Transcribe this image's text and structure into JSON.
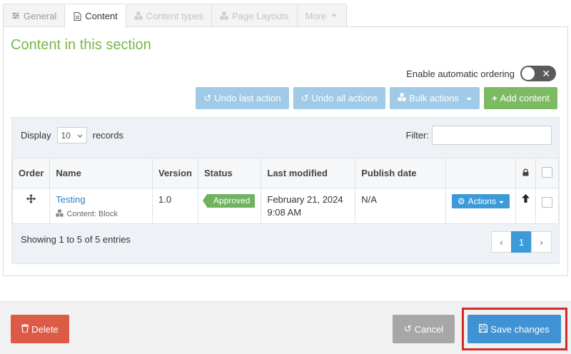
{
  "tabs": [
    {
      "label": "General",
      "icon": "sliders-icon"
    },
    {
      "label": "Content",
      "icon": "document-icon"
    },
    {
      "label": "Content types",
      "icon": "cubes-icon"
    },
    {
      "label": "Page Layouts",
      "icon": "cubes-icon"
    },
    {
      "label": "More",
      "icon": "caret-down-icon"
    }
  ],
  "section": {
    "title": "Content in this section",
    "auto_ordering_label": "Enable automatic ordering",
    "auto_ordering_enabled": false
  },
  "toolbar": {
    "undo_last": "Undo last action",
    "undo_all": "Undo all actions",
    "bulk": "Bulk actions",
    "add": "Add content"
  },
  "table_controls": {
    "display_label": "Display",
    "display_value": "10",
    "records_label": "records",
    "filter_label": "Filter:",
    "filter_value": ""
  },
  "columns": [
    "Order",
    "Name",
    "Version",
    "Status",
    "Last modified",
    "Publish date",
    "",
    "",
    ""
  ],
  "rows": [
    {
      "name": "Testing",
      "type": "Content: Block",
      "version": "1.0",
      "status": "Approved",
      "last_modified_date": "February 21, 2024",
      "last_modified_time": "9:08 AM",
      "publish_date": "N/A",
      "actions": "Actions"
    }
  ],
  "footer_info": {
    "showing": "Showing 1 to 5 of 5 entries",
    "current_page": "1",
    "prev": "‹",
    "next": "›"
  },
  "footer": {
    "delete": "Delete",
    "cancel": "Cancel",
    "save": "Save changes"
  },
  "colors": {
    "accent": "#3f92d3",
    "title_green": "#7ab648",
    "danger": "#dc5b47",
    "highlight": "#d42a2a"
  }
}
